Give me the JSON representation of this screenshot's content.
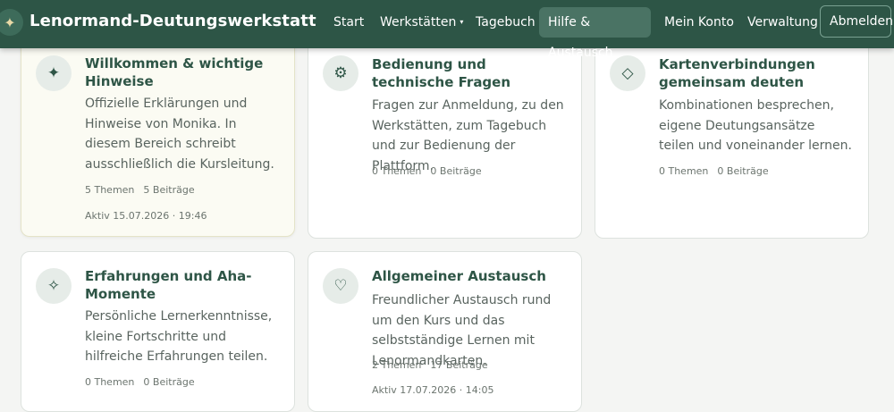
{
  "header": {
    "logo_glyph": "✦",
    "brand": "Lenormand-Deutungswerkstatt",
    "nav": [
      {
        "label": "Start"
      },
      {
        "label": "Werkstätten",
        "caret": "▾"
      },
      {
        "label": "Tagebuch"
      },
      {
        "label": "Hilfe & Austausch"
      },
      {
        "label": "Mein Konto"
      },
      {
        "label": "Verwaltung"
      },
      {
        "label": "Abmelden"
      }
    ]
  },
  "categories": [
    {
      "icon": "sparkle-icon",
      "glyph": "✦",
      "title": "Willkommen & wichtige Hinweise",
      "description": "Offizielle Erklärungen und Hinweise von Monika. In diesem Bereich schreibt ausschließlich die Kursleitung.",
      "topics": "5 Themen",
      "posts": "5 Beiträge",
      "activity": "Aktiv 15.07.2026 · 19:46"
    },
    {
      "icon": "gear-icon",
      "glyph": "⚙",
      "title": "Bedienung und technische Fragen",
      "description": "Fragen zur Anmeldung, zu den Werkstätten, zum Tagebuch und zur Bedienung der Plattform.",
      "topics": "0 Themen",
      "posts": "0 Beiträge",
      "activity": ""
    },
    {
      "icon": "diamond-icon",
      "glyph": "◇",
      "title": "Kartenverbindungen gemeinsam deuten",
      "description": "Kombinationen besprechen, eigene Deutungsansätze teilen und voneinander lernen.",
      "topics": "0 Themen",
      "posts": "0 Beiträge",
      "activity": ""
    },
    {
      "icon": "star-outline-icon",
      "glyph": "✧",
      "title": "Erfahrungen und Aha-Momente",
      "description": "Persönliche Lernerkenntnisse, kleine Fortschritte und hilfreiche Erfahrungen teilen.",
      "topics": "0 Themen",
      "posts": "0 Beiträge",
      "activity": ""
    },
    {
      "icon": "heart-icon",
      "glyph": "♡",
      "title": "Allgemeiner Austausch",
      "description": "Freundlicher Austausch rund um den Kurs und das selbstständige Lernen mit Lenormandkarten.",
      "topics": "2 Themen",
      "posts": "17 Beiträge",
      "activity": "Aktiv 17.07.2026 · 14:05"
    }
  ]
}
